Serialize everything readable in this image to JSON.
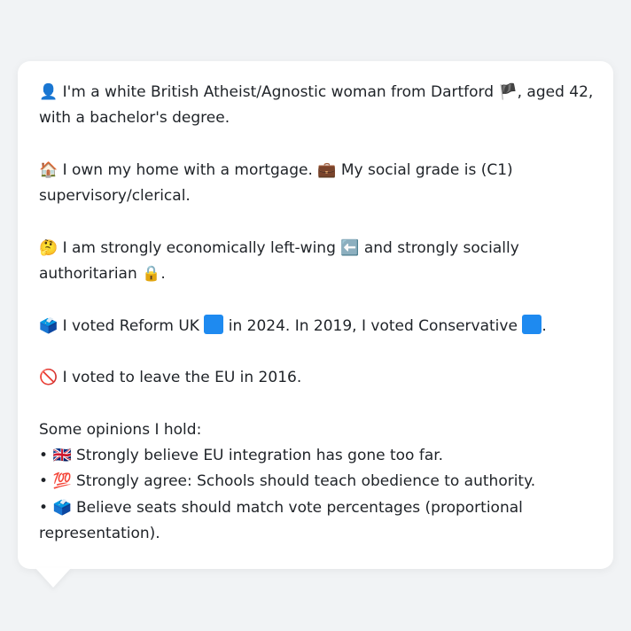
{
  "profile": {
    "p1": {
      "icon": "👤",
      "text_a": "I'm a white British Atheist/Agnostic woman from Dartford",
      "flag": "🏴",
      "text_b": ", aged 42, with a bachelor's degree."
    },
    "p2": {
      "icon_home": "🏠",
      "text_a": "I own my home with a mortgage.",
      "icon_brief": "💼",
      "text_b": "My social grade is (C1) supervisory/clerical."
    },
    "p3": {
      "icon": "🤔",
      "text_a": "I am strongly economically left-wing",
      "icon_left": "⬅️",
      "text_b": "and strongly socially authoritarian",
      "icon_lock": "🔒",
      "text_c": "."
    },
    "p4": {
      "icon": "🗳️",
      "text_a": "I voted Reform UK",
      "text_b": "in 2024. In 2019, I voted Conservative",
      "text_c": "."
    },
    "p5": {
      "icon": "🚫",
      "text": "I voted to leave the EU in 2016."
    },
    "opinions": {
      "heading": "Some opinions I hold:",
      "items": [
        {
          "bullet": "•",
          "icon": "🇬🇧",
          "text": "Strongly believe EU integration has gone too far."
        },
        {
          "bullet": "•",
          "icon": "💯",
          "text": "Strongly agree: Schools should teach obedience to authority."
        },
        {
          "bullet": "•",
          "icon": "🗳️",
          "text": "Believe seats should match vote percentages (proportional representation)."
        }
      ]
    }
  },
  "colors": {
    "background": "#f1f3f5",
    "bubble": "#ffffff",
    "text": "#1f2328",
    "party_square": "#1e8af0"
  }
}
